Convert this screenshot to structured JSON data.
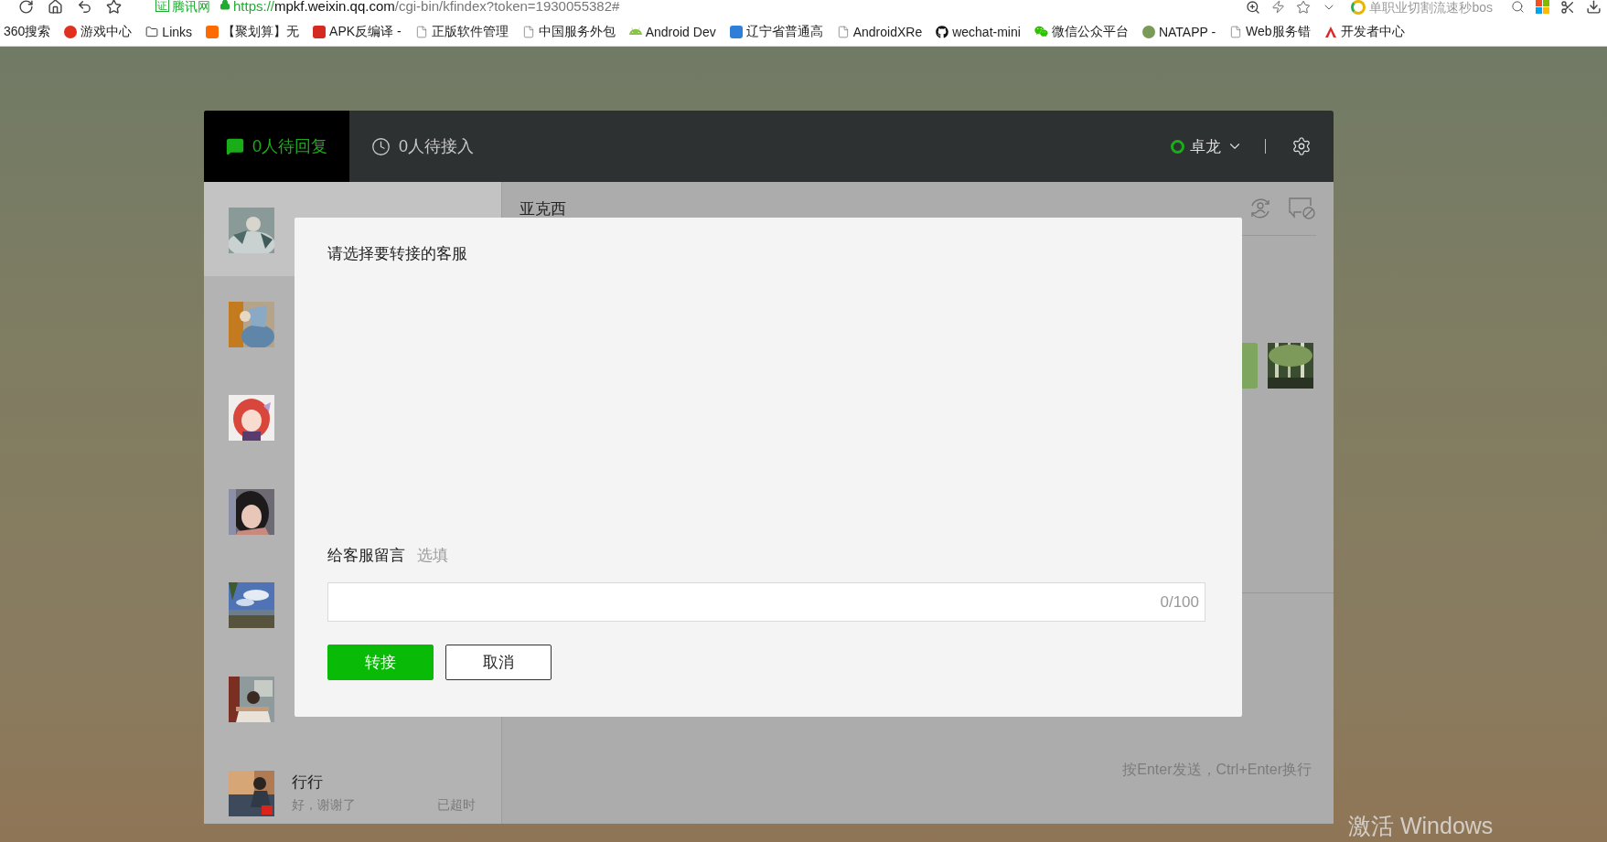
{
  "browser": {
    "site_badge": "证",
    "site_label": "腾讯网",
    "url_scheme": "https://",
    "url_host": "mpkf.weixin.qq.com",
    "url_path": "/cgi-bin/kfindex?token=1930055382#",
    "search_text": "单职业切割流速秒bos",
    "bookmarks": [
      {
        "label": "360搜索",
        "kind": "plain"
      },
      {
        "label": "游戏中心",
        "kind": "game"
      },
      {
        "label": "Links",
        "kind": "folder"
      },
      {
        "label": "【聚划算】无",
        "kind": "taobao"
      },
      {
        "label": "APK反编译 -",
        "kind": "apk"
      },
      {
        "label": "正版软件管理",
        "kind": "page"
      },
      {
        "label": "中国服务外包",
        "kind": "page"
      },
      {
        "label": "Android Dev",
        "kind": "android"
      },
      {
        "label": "辽宁省普通高",
        "kind": "blue"
      },
      {
        "label": "AndroidXRe",
        "kind": "page"
      },
      {
        "label": "wechat-mini",
        "kind": "github"
      },
      {
        "label": "微信公众平台",
        "kind": "wechat"
      },
      {
        "label": "NATAPP -",
        "kind": "ring"
      },
      {
        "label": "Web服务错",
        "kind": "page"
      },
      {
        "label": "开发者中心",
        "kind": "dev"
      }
    ]
  },
  "header": {
    "tabs": [
      {
        "label": "0人待回复",
        "kind": "chat",
        "selected": true
      },
      {
        "label": "0人待接入",
        "kind": "clock",
        "selected": false
      }
    ],
    "agent": {
      "name": "卓龙",
      "online": true
    }
  },
  "conversations": [
    {
      "selected": true
    },
    {
      "selected": false
    },
    {
      "selected": false
    },
    {
      "selected": false
    },
    {
      "selected": false
    },
    {
      "selected": false
    },
    {
      "name": "行行",
      "preview": "好，谢谢了",
      "status": "已超时",
      "selected": false
    }
  ],
  "chat": {
    "title": "亚克西",
    "input_hint": "按Enter发送，Ctrl+Enter换行"
  },
  "dialog": {
    "title": "请选择要转接的客服",
    "message_label": "给客服留言",
    "message_optional": "选填",
    "counter": "0/100",
    "buttons": [
      {
        "label": "转接",
        "kind": "primary"
      },
      {
        "label": "取消",
        "kind": "secondary"
      }
    ]
  },
  "desktop": {
    "activation_notice": "激活 Windows"
  }
}
